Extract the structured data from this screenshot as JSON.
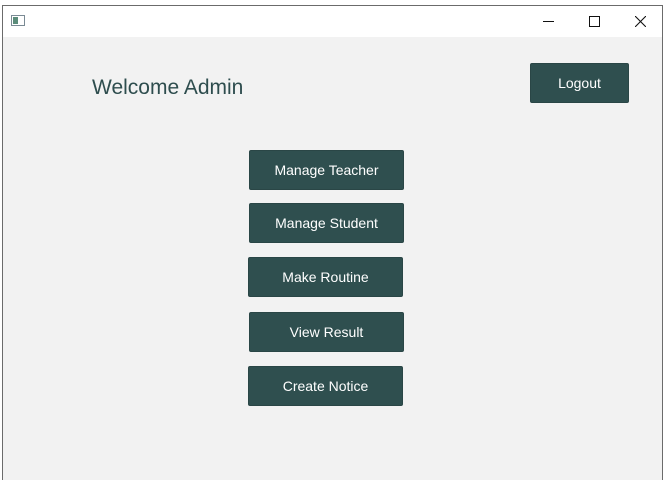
{
  "window": {
    "title": "",
    "icon": "app-window-icon",
    "controls": {
      "minimize_icon": "minimize-icon",
      "maximize_icon": "maximize-icon",
      "close_icon": "close-icon"
    }
  },
  "header": {
    "welcome_text": "Welcome Admin",
    "logout_label": "Logout"
  },
  "menu": {
    "manage_teacher": "Manage Teacher",
    "manage_student": "Manage Student",
    "make_routine": "Make Routine",
    "view_result": "View Result",
    "create_notice": "Create Notice"
  },
  "colors": {
    "button_bg": "#2f4f4f",
    "button_text": "#ffffff",
    "background": "#f2f2f2",
    "welcome_text": "#2e4d4e"
  }
}
